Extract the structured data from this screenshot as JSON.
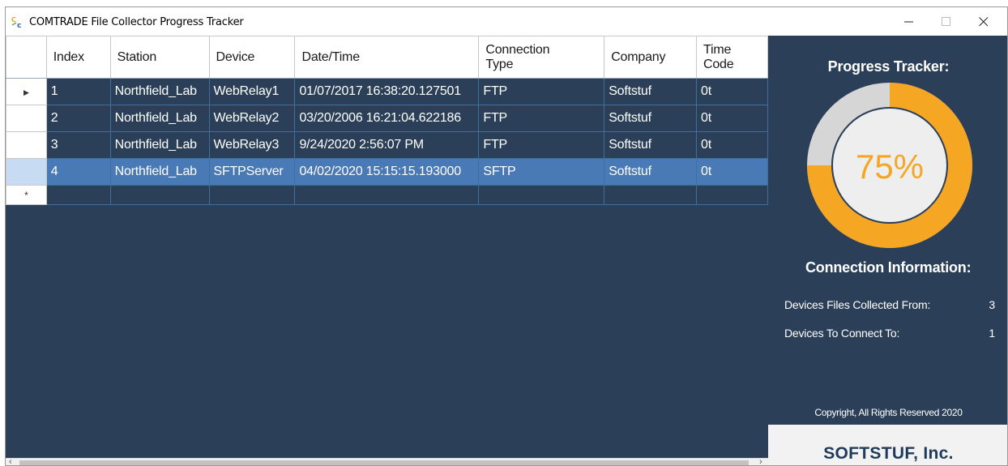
{
  "window": {
    "title": "COMTRADE File Collector Progress Tracker",
    "icon": "comtrade-app-icon"
  },
  "grid": {
    "columns": [
      "Index",
      "Station",
      "Device",
      "Date/Time",
      "Connection Type",
      "Company",
      "Time Code"
    ],
    "rows": [
      {
        "index": "1",
        "station": "Northfield_Lab",
        "device": "WebRelay1",
        "datetime": "01/07/2017 16:38:20.127501",
        "connection": "FTP",
        "company": "Softstuf",
        "timecode": "0t",
        "selected": false,
        "current": true
      },
      {
        "index": "2",
        "station": "Northfield_Lab",
        "device": "WebRelay2",
        "datetime": "03/20/2006 16:21:04.622186",
        "connection": "FTP",
        "company": "Softstuf",
        "timecode": "0t",
        "selected": false,
        "current": false
      },
      {
        "index": "3",
        "station": "Northfield_Lab",
        "device": "WebRelay3",
        "datetime": "9/24/2020 2:56:07 PM",
        "connection": "FTP",
        "company": "Softstuf",
        "timecode": "0t",
        "selected": false,
        "current": false
      },
      {
        "index": "4",
        "station": "Northfield_Lab",
        "device": "SFTPServer",
        "datetime": "04/02/2020 15:15:15.193000",
        "connection": "SFTP",
        "company": "Softstuf",
        "timecode": "0t",
        "selected": true,
        "current": false
      }
    ],
    "new_row_marker": "*",
    "current_row_marker": "▶"
  },
  "panel": {
    "title": "Progress Tracker:",
    "progress": 0.75,
    "progress_label": "75%",
    "connection_title": "Connection Information:",
    "files_collected_label": "Devices Files Collected From:",
    "files_collected_value": "3",
    "to_connect_label": "Devices To Connect To:",
    "to_connect_value": "1",
    "copyright": "Copyright, All Rights Reserved 2020",
    "brand": "SOFTSTUF, Inc."
  },
  "colors": {
    "background": "#2b4058",
    "accent": "#f5a623",
    "remaining": "#d6d6d6",
    "selected_row": "#4a7ab5",
    "brand": "#1f3b5c"
  }
}
